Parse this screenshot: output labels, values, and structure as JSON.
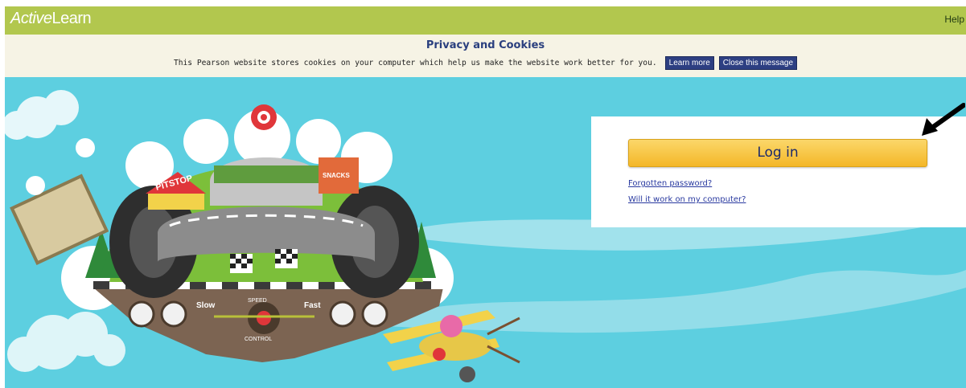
{
  "header": {
    "logo_italic": "Active",
    "logo_rest": "Learn",
    "help_label": "Help"
  },
  "cookie_banner": {
    "title": "Privacy and Cookies",
    "message": "This Pearson website stores cookies on your computer which help us make the website work better for you.",
    "learn_more_label": "Learn more",
    "close_label": "Close this message"
  },
  "login": {
    "button_label": "Log in",
    "forgot_password_label": "Forgotten password?",
    "compatibility_label": "Will it work on my computer?"
  },
  "illustration": {
    "pitstop_sign": "PITSTOP",
    "snacks_sign": "SNACKS",
    "slow_label": "Slow",
    "fast_label": "Fast",
    "speed_label": "SPEED",
    "control_label": "CONTROL"
  },
  "colors": {
    "header_bg": "#b2c74e",
    "banner_bg": "#f6f3e5",
    "sky": "#5dcfe0",
    "login_button": "#f4b728",
    "brand_blue": "#2d3f82"
  }
}
